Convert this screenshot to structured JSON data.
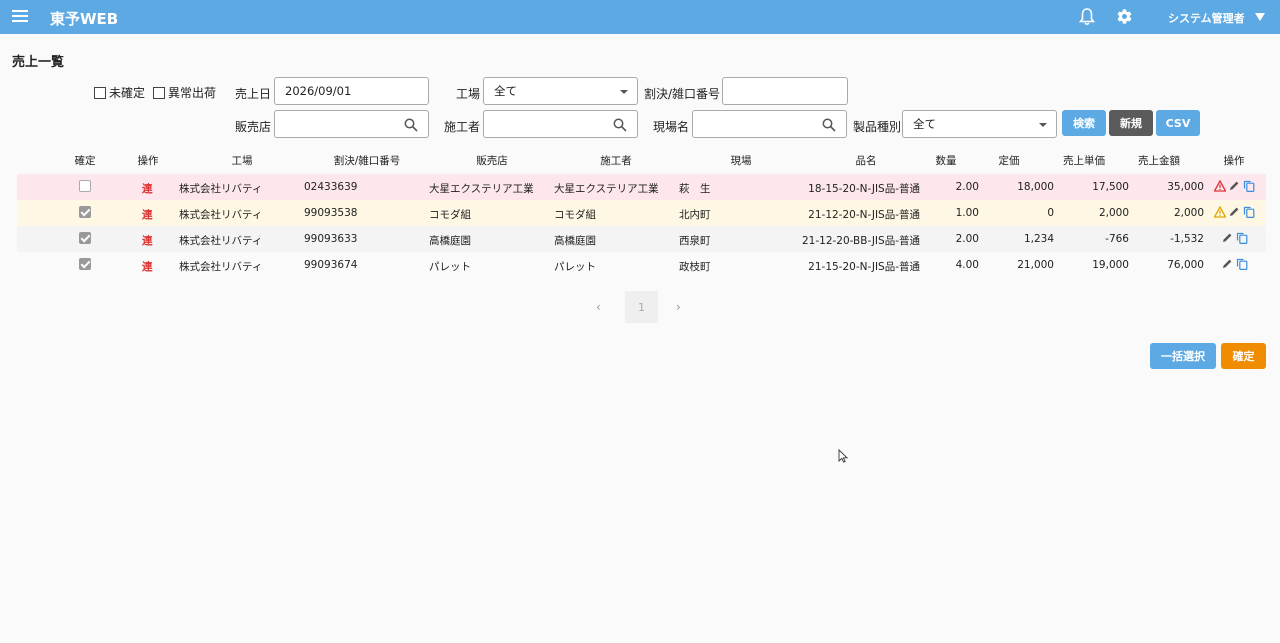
{
  "header": {
    "app_title": "東予WEB",
    "user": "システム管理者"
  },
  "page": {
    "title": "売上一覧"
  },
  "filters": {
    "unconfirmed_label": "未確定",
    "abnormal_label": "異常出荷",
    "sales_date_label": "売上日",
    "sales_date_value": "2026/09/01",
    "factory_label": "工場",
    "factory_value": "全て",
    "split_no_label": "割決/雑口番号",
    "split_no_value": "",
    "store_label": "販売店",
    "store_value": "",
    "contractor_label": "施工者",
    "contractor_value": "",
    "site_label": "現場名",
    "site_value": "",
    "product_type_label": "製品種別",
    "product_type_value": "全て"
  },
  "buttons": {
    "search": "検索",
    "new": "新規",
    "csv": "CSV",
    "bulk_select": "一括選択",
    "confirm": "確定"
  },
  "colors": {
    "header": "#5da9e3",
    "primary": "#5da9e3",
    "dark": "#5b5b5b",
    "confirm": "#f08c00",
    "row_error": "#fde7ec",
    "row_warn": "#fdf7e3",
    "row_plain": "#f4f4f4"
  },
  "table": {
    "headers": {
      "confirm": "確定",
      "op": "操作",
      "factory": "工場",
      "split_no": "割決/雑口番号",
      "store": "販売店",
      "contractor": "施工者",
      "site": "現場",
      "product": "品名",
      "qty": "数量",
      "list_price": "定価",
      "unit_price": "売上単価",
      "amount": "売上金額",
      "actions": "操作"
    },
    "rows": [
      {
        "checked": false,
        "op": "連",
        "factory": "株式会社リバティ",
        "split_no": "02433639",
        "store": "大星エクステリア工業",
        "contractor": "大星エクステリア工業",
        "site": "萩　生",
        "product": "18-15-20-N-JIS品-普通",
        "qty": "2.00",
        "list_price": "18,000",
        "unit_price": "17,500",
        "amount": "35,000",
        "status": "error",
        "status_icon": "warning-red-icon"
      },
      {
        "checked": true,
        "op": "連",
        "factory": "株式会社リバティ",
        "split_no": "99093538",
        "store": "コモダ組",
        "contractor": "コモダ組",
        "site": "北内町",
        "product": "21-12-20-N-JIS品-普通",
        "qty": "1.00",
        "list_price": "0",
        "unit_price": "2,000",
        "amount": "2,000",
        "status": "warn",
        "status_icon": "warning-yellow-icon"
      },
      {
        "checked": true,
        "op": "連",
        "factory": "株式会社リバティ",
        "split_no": "99093633",
        "store": "高橋庭園",
        "contractor": "高橋庭園",
        "site": "西泉町",
        "product": "21-12-20-BB-JIS品-普通",
        "qty": "2.00",
        "list_price": "1,234",
        "unit_price": "-766",
        "amount": "-1,532",
        "status": "plain",
        "status_icon": ""
      },
      {
        "checked": true,
        "op": "連",
        "factory": "株式会社リバティ",
        "split_no": "99093674",
        "store": "パレット",
        "contractor": "パレット",
        "site": "政枝町",
        "product": "21-15-20-N-JIS品-普通",
        "qty": "4.00",
        "list_price": "21,000",
        "unit_price": "19,000",
        "amount": "76,000",
        "status": "none",
        "status_icon": ""
      }
    ]
  },
  "pager": {
    "current": "1",
    "prev": "‹",
    "next": "›"
  }
}
